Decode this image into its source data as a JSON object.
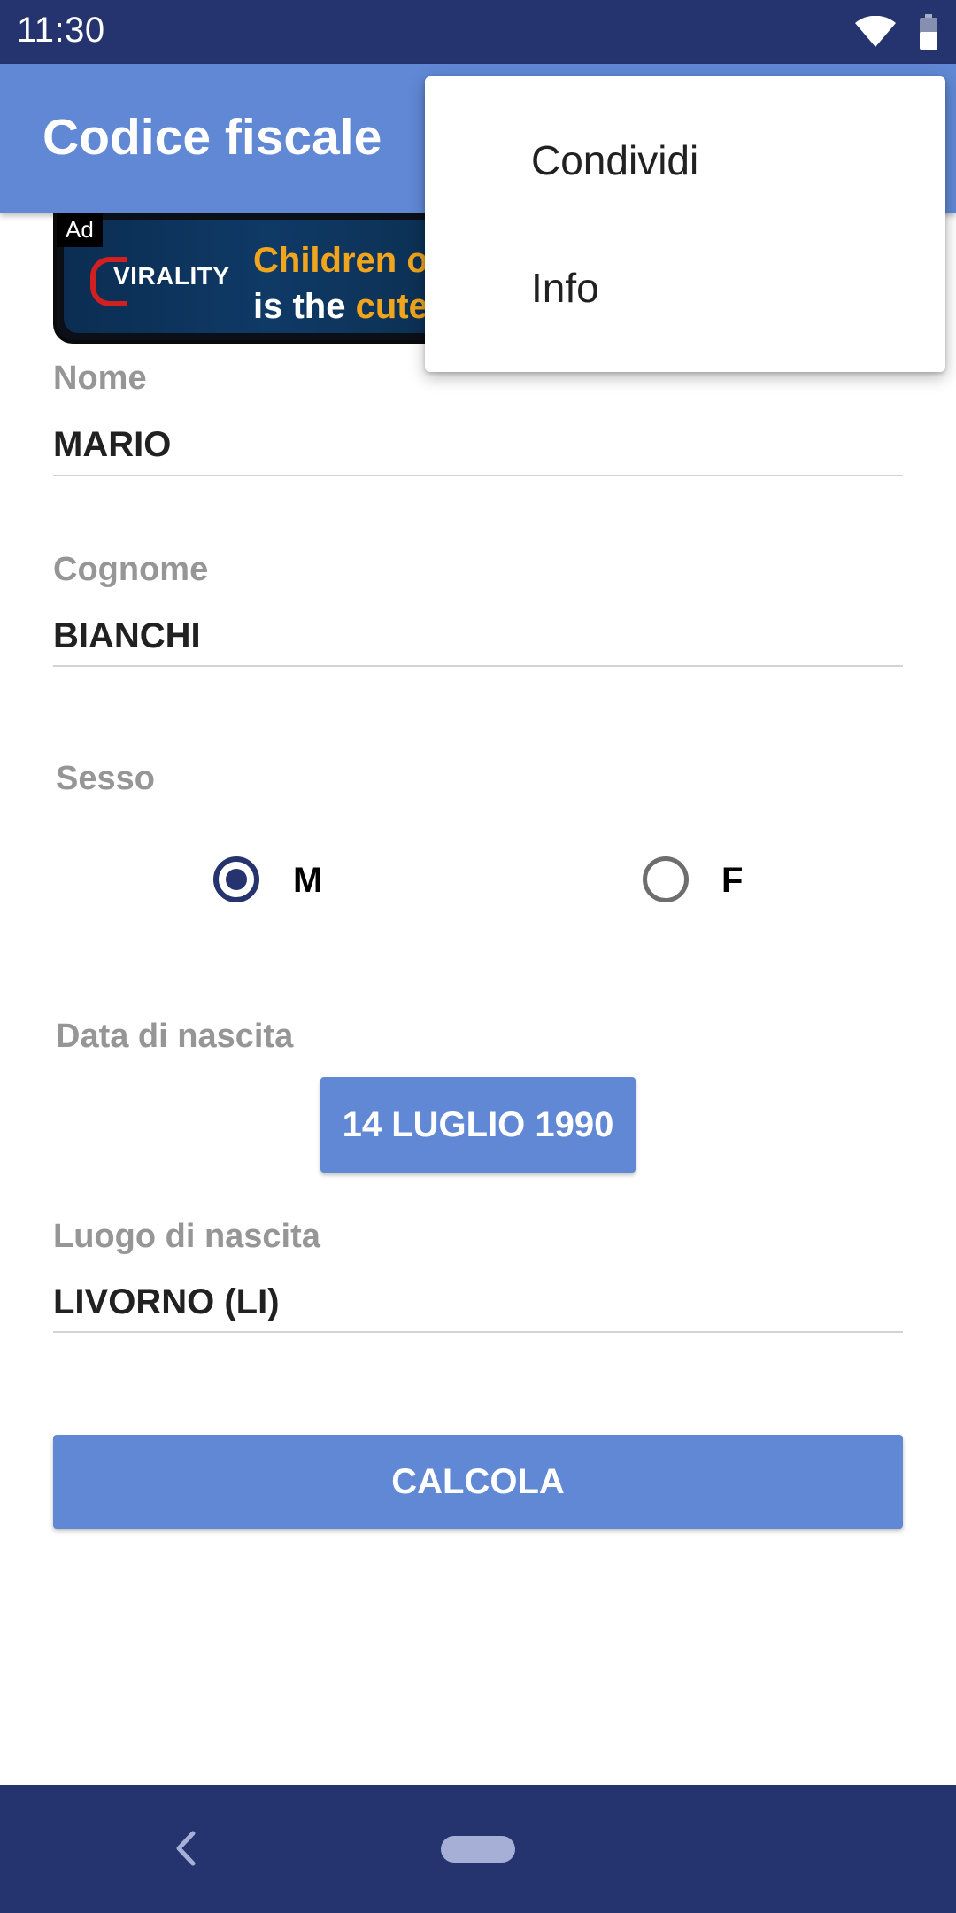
{
  "status_bar": {
    "time": "11:30",
    "icons": [
      "wifi-icon",
      "battery-icon"
    ]
  },
  "app_bar": {
    "title": "Codice fiscale"
  },
  "ad": {
    "badge": "Ad",
    "logo": "VIRALITY",
    "line1": "Children o",
    "line2_part1": "is the ",
    "line2_accent": "cute"
  },
  "form": {
    "nome": {
      "label": "Nome",
      "value": "MARIO"
    },
    "cognome": {
      "label": "Cognome",
      "value": "BIANCHI"
    },
    "sesso": {
      "label": "Sesso",
      "options": [
        {
          "label": "M",
          "checked": true
        },
        {
          "label": "F",
          "checked": false
        }
      ]
    },
    "data_nascita": {
      "label": "Data di nascita",
      "value": "14 LUGLIO 1990"
    },
    "luogo_nascita": {
      "label": "Luogo di nascita",
      "value": "LIVORNO (LI)"
    },
    "calcola_label": "CALCOLA"
  },
  "overflow_menu": {
    "items": [
      {
        "label": "Condividi"
      },
      {
        "label": "Info"
      }
    ]
  },
  "nav_bar": {
    "icons": [
      "back-icon",
      "home-pill"
    ]
  },
  "colors": {
    "primary": "#6088d4",
    "primary_dark": "#25336f",
    "label_gray": "#969696"
  }
}
